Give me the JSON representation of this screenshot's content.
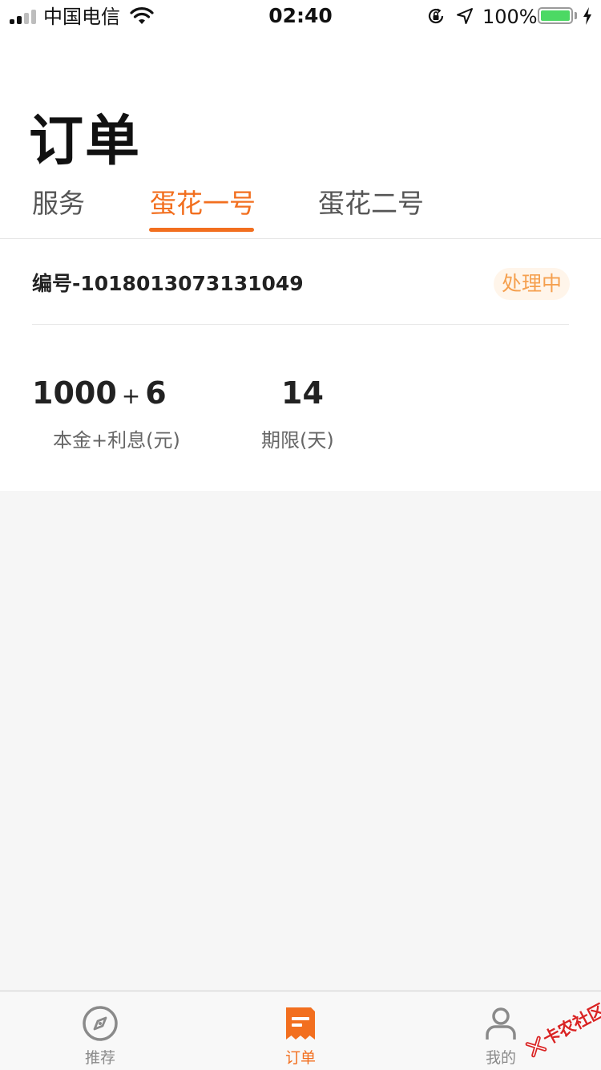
{
  "status_bar": {
    "carrier": "中国电信",
    "time": "02:40",
    "battery_percent": "100%",
    "battery_level": 1.0,
    "signal_bars_filled": 2,
    "signal_bars_total": 4,
    "icons": [
      "signal-icon",
      "wifi-icon",
      "rotation-lock-icon",
      "location-arrow-icon",
      "battery-icon",
      "charging-bolt-icon"
    ]
  },
  "header": {
    "title": "订单",
    "tabs": [
      {
        "label": "服务",
        "active": false
      },
      {
        "label": "蛋花一号",
        "active": true
      },
      {
        "label": "蛋花二号",
        "active": false
      }
    ]
  },
  "order": {
    "number": "编号-1018013073131049",
    "status": "处理中",
    "principal": "1000",
    "plus": "+",
    "interest": "6",
    "amount_label": "本金+利息(元)",
    "term_value": "14",
    "term_label": "期限(天)"
  },
  "tabbar": {
    "items": [
      {
        "label": "推荐",
        "icon": "compass-icon",
        "active": false
      },
      {
        "label": "订单",
        "icon": "document-icon",
        "active": true
      },
      {
        "label": "我的",
        "icon": "person-icon",
        "active": false
      }
    ]
  },
  "watermark": {
    "text": "卡农社区"
  },
  "colors": {
    "accent": "#f26f1f",
    "status_badge_text": "#f5a04f",
    "status_badge_bg": "#fff5ea",
    "page_bg": "#f6f6f6",
    "battery_fill": "#4cd964",
    "watermark": "#d92424"
  }
}
